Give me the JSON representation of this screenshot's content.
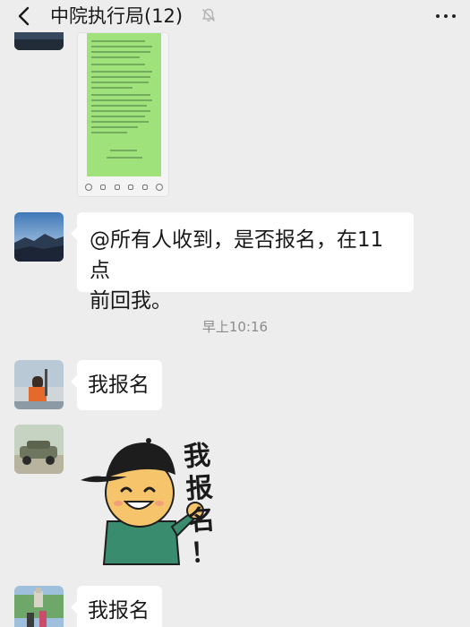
{
  "header": {
    "title": "中院执行局(12)",
    "back_icon": "chevron-left-icon",
    "mute_icon": "bell-muted-icon",
    "more_icon": "more-dots-icon"
  },
  "messages": {
    "msg1": {
      "type": "image",
      "description_icon": "screenshot-thumbnail"
    },
    "msg2": {
      "type": "text",
      "text_line1": "@所有人收到，是否报名，在11点",
      "text_line2": "前回我。"
    },
    "timestamp": "早上10:16",
    "msg3": {
      "type": "text",
      "text": "我报名"
    },
    "msg4": {
      "type": "sticker",
      "caption": "我报名！"
    },
    "msg5": {
      "type": "text",
      "text": "我报名"
    }
  },
  "colors": {
    "background": "#ededed",
    "bubble": "#ffffff",
    "image_green": "#9fe27c"
  }
}
